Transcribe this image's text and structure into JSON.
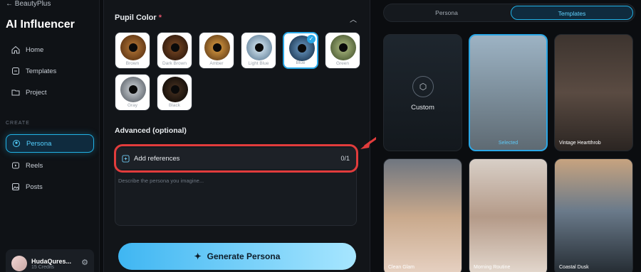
{
  "sidebar": {
    "back_label": "← BeautyPlus",
    "app_title": "AI Influencer",
    "nav": [
      {
        "label": "Home",
        "icon": "home-icon"
      },
      {
        "label": "Templates",
        "icon": "templates-icon"
      },
      {
        "label": "Project",
        "icon": "folder-icon"
      }
    ],
    "section_create": "CREATE",
    "create_nav": [
      {
        "label": "Persona",
        "icon": "persona-icon",
        "active": true
      },
      {
        "label": "Reels",
        "icon": "reels-icon"
      },
      {
        "label": "Posts",
        "icon": "posts-icon"
      }
    ],
    "user": {
      "name": "HudaQures...",
      "credits": "15 Credits"
    }
  },
  "main": {
    "pupil_color_label": "Pupil Color",
    "required_mark": "*",
    "swatches": [
      {
        "label": "Brown",
        "color": "#7a4a21",
        "selected": false
      },
      {
        "label": "Dark Brown",
        "color": "#4a2b16",
        "selected": false
      },
      {
        "label": "Amber",
        "color": "#9a6a2a",
        "selected": false
      },
      {
        "label": "Light Blue",
        "color": "#9fb9cc",
        "selected": false
      },
      {
        "label": "Blue",
        "color": "#3a5d80",
        "selected": true
      },
      {
        "label": "Green",
        "color": "#7a8a5c",
        "selected": false
      },
      {
        "label": "Gray",
        "color": "#9aa0a6",
        "selected": false
      },
      {
        "label": "Black",
        "color": "#2a1e16",
        "selected": false
      }
    ],
    "advanced_label": "Advanced (optional)",
    "add_references_label": "Add references",
    "references_count": "0/1",
    "describe_placeholder": "Describe the persona you imagine...",
    "generate_button": "Generate Persona"
  },
  "right": {
    "tabs": [
      {
        "label": "Persona",
        "active": false
      },
      {
        "label": "Templates",
        "active": true
      }
    ],
    "custom_label": "Custom",
    "selected_label": "Selected",
    "templates": [
      {
        "caption": "",
        "selected": true,
        "bg": "#8fa3b2"
      },
      {
        "caption": "Vintage Heartthrob",
        "selected": false,
        "bg": "#5a4b42"
      },
      {
        "caption": "Clean Glam",
        "selected": false,
        "bg": "#8a7a6a"
      },
      {
        "caption": "Morning Routine",
        "selected": false,
        "bg": "#9a8a80"
      },
      {
        "caption": "Coastal Dusk",
        "selected": false,
        "bg": "#6a7a8a"
      }
    ]
  }
}
